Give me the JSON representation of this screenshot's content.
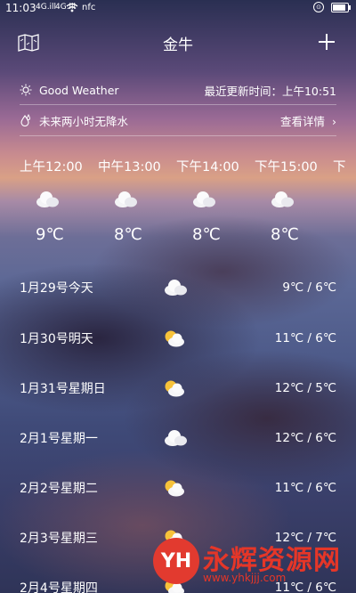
{
  "status_bar": {
    "time": "11:03",
    "signal_1": "4G.ill",
    "signal_2": "4G.ill",
    "nfc_label": "nfc"
  },
  "header": {
    "title": "金牛",
    "map_icon": "map-icon",
    "add_icon": "plus-icon"
  },
  "weather_row": {
    "condition": "Good Weather",
    "updated": "最近更新时间：上午10:51"
  },
  "rain_row": {
    "text": "未来两小时无降水",
    "details_label": "查看详情",
    "chevron": "›"
  },
  "hourly": [
    {
      "label": "上午12:00",
      "temp": "9℃",
      "icon": "cloudy-icon"
    },
    {
      "label": "中午13:00",
      "temp": "8℃",
      "icon": "cloudy-icon"
    },
    {
      "label": "下午14:00",
      "temp": "8℃",
      "icon": "cloudy-icon"
    },
    {
      "label": "下午15:00",
      "temp": "8℃",
      "icon": "cloudy-icon"
    }
  ],
  "hourly_overflow": "下",
  "daily": [
    {
      "name": "1月29号今天",
      "range": "9℃ / 6℃",
      "icon": "cloudy-icon"
    },
    {
      "name": "1月30号明天",
      "range": "11℃ / 6℃",
      "icon": "partly-cloudy-icon"
    },
    {
      "name": "1月31号星期日",
      "range": "12℃ / 5℃",
      "icon": "partly-cloudy-icon"
    },
    {
      "name": "2月1号星期一",
      "range": "12℃ / 6℃",
      "icon": "cloudy-icon"
    },
    {
      "name": "2月2号星期二",
      "range": "11℃ / 6℃",
      "icon": "partly-cloudy-icon"
    },
    {
      "name": "2月3号星期三",
      "range": "12℃ / 7℃",
      "icon": "partly-cloudy-icon"
    },
    {
      "name": "2月4号星期四",
      "range": "11℃ / 6℃",
      "icon": "partly-cloudy-icon"
    }
  ],
  "watermark": {
    "logo": "YH",
    "text": "永辉资源网",
    "url": "www.yhkjjj.com"
  }
}
